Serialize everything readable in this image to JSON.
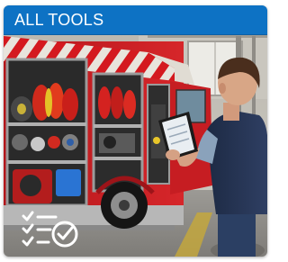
{
  "card": {
    "title": "ALL TOOLS",
    "accent_color": "#0d72c4",
    "badge_icon": "checklist-check-icon"
  }
}
